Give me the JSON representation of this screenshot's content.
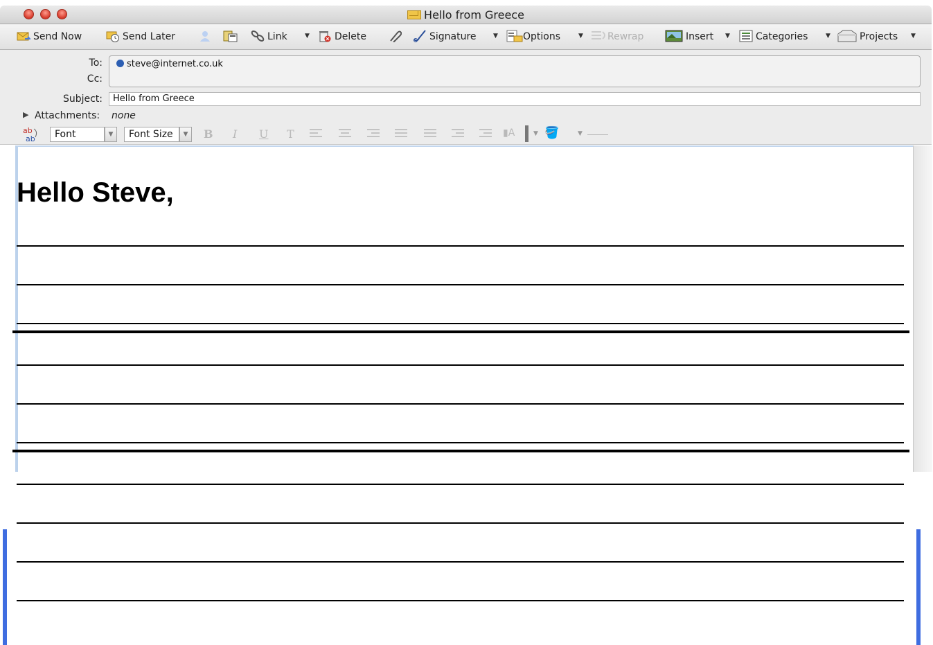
{
  "window": {
    "title": "Hello from Greece"
  },
  "toolbar": {
    "send_now": "Send Now",
    "send_later": "Send Later",
    "link": "Link",
    "delete": "Delete",
    "signature": "Signature",
    "options": "Options",
    "rewrap": "Rewrap",
    "insert": "Insert",
    "categories": "Categories",
    "projects": "Projects"
  },
  "headers": {
    "to_label": "To:",
    "to_value": "steve@internet.co.uk",
    "cc_label": "Cc:",
    "subject_label": "Subject:",
    "subject_value": "Hello from Greece",
    "attachments_label": "Attachments:",
    "attachments_value": "none"
  },
  "format": {
    "font": "Font",
    "font_size": "Font Size",
    "bold": "B",
    "italic": "I",
    "underline": "U",
    "type": "T"
  },
  "body": {
    "greeting": "Hello Steve,"
  },
  "colors": {
    "accent_blue": "#3f6de0",
    "traffic_red": "#d6392a"
  }
}
